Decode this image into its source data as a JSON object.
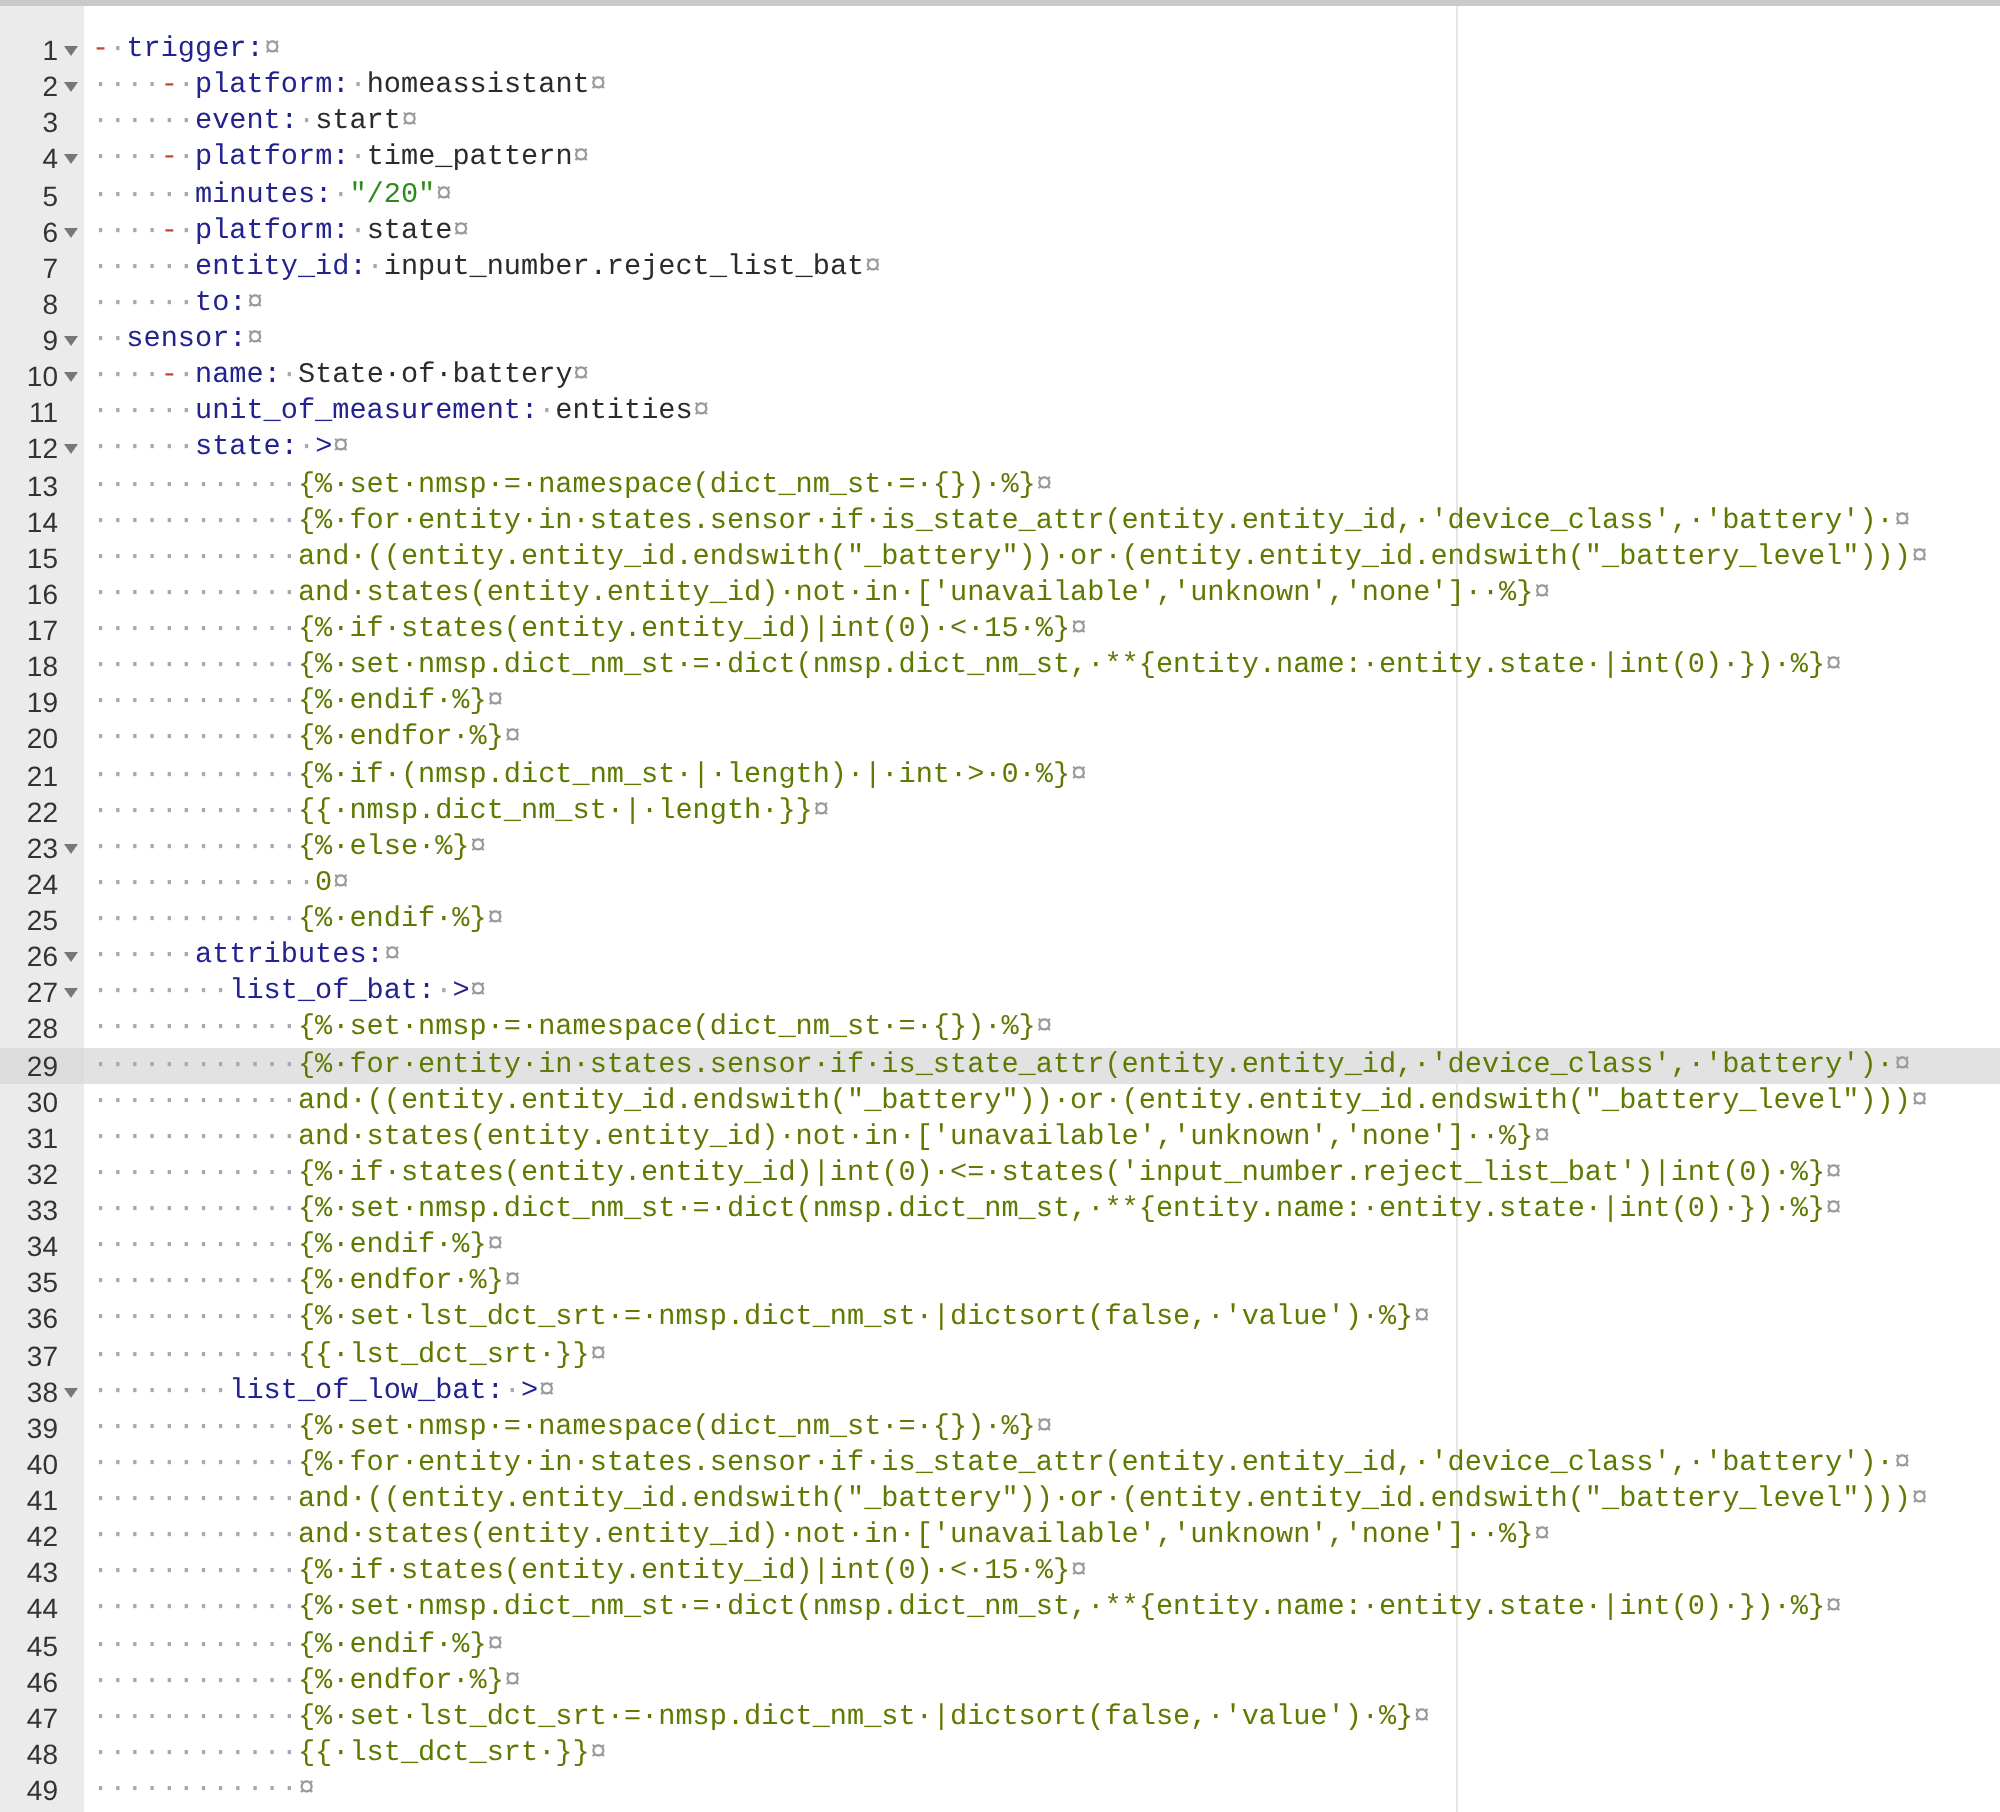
{
  "editor": {
    "lines": [
      {
        "number": "1",
        "fold": true,
        "current": false,
        "tokens": [
          {
            "kind": "dash",
            "text": "-"
          },
          {
            "kind": "ws",
            "text": "·"
          },
          {
            "kind": "key",
            "text": "trigger:"
          },
          {
            "kind": "eol",
            "text": "¤"
          }
        ]
      },
      {
        "number": "2",
        "fold": true,
        "current": false,
        "tokens": [
          {
            "kind": "ws",
            "text": "····"
          },
          {
            "kind": "dash",
            "text": "-"
          },
          {
            "kind": "ws",
            "text": "·"
          },
          {
            "kind": "key",
            "text": "platform:"
          },
          {
            "kind": "ws",
            "text": "·"
          },
          {
            "kind": "value",
            "text": "homeassistant"
          },
          {
            "kind": "eol",
            "text": "¤"
          }
        ]
      },
      {
        "number": "3",
        "fold": false,
        "current": false,
        "tokens": [
          {
            "kind": "ws",
            "text": "······"
          },
          {
            "kind": "key",
            "text": "event:"
          },
          {
            "kind": "ws",
            "text": "·"
          },
          {
            "kind": "value",
            "text": "start"
          },
          {
            "kind": "eol",
            "text": "¤"
          }
        ]
      },
      {
        "number": "4",
        "fold": true,
        "current": false,
        "tokens": [
          {
            "kind": "ws",
            "text": "····"
          },
          {
            "kind": "dash",
            "text": "-"
          },
          {
            "kind": "ws",
            "text": "·"
          },
          {
            "kind": "key",
            "text": "platform:"
          },
          {
            "kind": "ws",
            "text": "·"
          },
          {
            "kind": "value",
            "text": "time_pattern"
          },
          {
            "kind": "eol",
            "text": "¤"
          }
        ]
      },
      {
        "number": "5",
        "fold": false,
        "current": false,
        "tokens": [
          {
            "kind": "ws",
            "text": "······"
          },
          {
            "kind": "key",
            "text": "minutes:"
          },
          {
            "kind": "ws",
            "text": "·"
          },
          {
            "kind": "string",
            "text": "\"/20\""
          },
          {
            "kind": "eol",
            "text": "¤"
          }
        ]
      },
      {
        "number": "6",
        "fold": true,
        "current": false,
        "tokens": [
          {
            "kind": "ws",
            "text": "····"
          },
          {
            "kind": "dash",
            "text": "-"
          },
          {
            "kind": "ws",
            "text": "·"
          },
          {
            "kind": "key",
            "text": "platform:"
          },
          {
            "kind": "ws",
            "text": "·"
          },
          {
            "kind": "value",
            "text": "state"
          },
          {
            "kind": "eol",
            "text": "¤"
          }
        ]
      },
      {
        "number": "7",
        "fold": false,
        "current": false,
        "tokens": [
          {
            "kind": "ws",
            "text": "······"
          },
          {
            "kind": "key",
            "text": "entity_id:"
          },
          {
            "kind": "ws",
            "text": "·"
          },
          {
            "kind": "value",
            "text": "input_number.reject_list_bat"
          },
          {
            "kind": "eol",
            "text": "¤"
          }
        ]
      },
      {
        "number": "8",
        "fold": false,
        "current": false,
        "tokens": [
          {
            "kind": "ws",
            "text": "······"
          },
          {
            "kind": "key",
            "text": "to:"
          },
          {
            "kind": "eol",
            "text": "¤"
          }
        ]
      },
      {
        "number": "9",
        "fold": true,
        "current": false,
        "tokens": [
          {
            "kind": "ws",
            "text": "··"
          },
          {
            "kind": "key",
            "text": "sensor:"
          },
          {
            "kind": "eol",
            "text": "¤"
          }
        ]
      },
      {
        "number": "10",
        "fold": true,
        "current": false,
        "tokens": [
          {
            "kind": "ws",
            "text": "····"
          },
          {
            "kind": "dash",
            "text": "-"
          },
          {
            "kind": "ws",
            "text": "·"
          },
          {
            "kind": "key",
            "text": "name:"
          },
          {
            "kind": "ws",
            "text": "·"
          },
          {
            "kind": "value",
            "text": "State·of·battery"
          },
          {
            "kind": "eol",
            "text": "¤"
          }
        ]
      },
      {
        "number": "11",
        "fold": false,
        "current": false,
        "tokens": [
          {
            "kind": "ws",
            "text": "······"
          },
          {
            "kind": "key",
            "text": "unit_of_measurement:"
          },
          {
            "kind": "ws",
            "text": "·"
          },
          {
            "kind": "value",
            "text": "entities"
          },
          {
            "kind": "eol",
            "text": "¤"
          }
        ]
      },
      {
        "number": "12",
        "fold": true,
        "current": false,
        "tokens": [
          {
            "kind": "ws",
            "text": "······"
          },
          {
            "kind": "key",
            "text": "state:"
          },
          {
            "kind": "ws",
            "text": "·"
          },
          {
            "kind": "indicator",
            "text": ">"
          },
          {
            "kind": "eol",
            "text": "¤"
          }
        ]
      },
      {
        "number": "13",
        "fold": false,
        "current": false,
        "tokens": [
          {
            "kind": "ws",
            "text": "············"
          },
          {
            "kind": "template",
            "text": "{%·set·nmsp·=·namespace(dict_nm_st·=·{})·%}"
          },
          {
            "kind": "eol",
            "text": "¤"
          }
        ]
      },
      {
        "number": "14",
        "fold": false,
        "current": false,
        "tokens": [
          {
            "kind": "ws",
            "text": "············"
          },
          {
            "kind": "template",
            "text": "{%·for·entity·in·states.sensor·if·is_state_attr(entity.entity_id,·'device_class',·'battery')·"
          },
          {
            "kind": "eol",
            "text": "¤"
          }
        ]
      },
      {
        "number": "15",
        "fold": false,
        "current": false,
        "tokens": [
          {
            "kind": "ws",
            "text": "············"
          },
          {
            "kind": "template",
            "text": "and·((entity.entity_id.endswith(\"_battery\"))·or·(entity.entity_id.endswith(\"_battery_level\")))"
          },
          {
            "kind": "eol",
            "text": "¤"
          }
        ]
      },
      {
        "number": "16",
        "fold": false,
        "current": false,
        "tokens": [
          {
            "kind": "ws",
            "text": "············"
          },
          {
            "kind": "template",
            "text": "and·states(entity.entity_id)·not·in·['unavailable','unknown','none']··%}"
          },
          {
            "kind": "eol",
            "text": "¤"
          }
        ]
      },
      {
        "number": "17",
        "fold": false,
        "current": false,
        "tokens": [
          {
            "kind": "ws",
            "text": "············"
          },
          {
            "kind": "template",
            "text": "{%·if·states(entity.entity_id)|int(0)·<·15·%}"
          },
          {
            "kind": "eol",
            "text": "¤"
          }
        ]
      },
      {
        "number": "18",
        "fold": false,
        "current": false,
        "tokens": [
          {
            "kind": "ws",
            "text": "············"
          },
          {
            "kind": "template",
            "text": "{%·set·nmsp.dict_nm_st·=·dict(nmsp.dict_nm_st,·**{entity.name:·entity.state·|int(0)·})·%}"
          },
          {
            "kind": "eol",
            "text": "¤"
          }
        ]
      },
      {
        "number": "19",
        "fold": false,
        "current": false,
        "tokens": [
          {
            "kind": "ws",
            "text": "············"
          },
          {
            "kind": "template",
            "text": "{%·endif·%}"
          },
          {
            "kind": "eol",
            "text": "¤"
          }
        ]
      },
      {
        "number": "20",
        "fold": false,
        "current": false,
        "tokens": [
          {
            "kind": "ws",
            "text": "············"
          },
          {
            "kind": "template",
            "text": "{%·endfor·%}"
          },
          {
            "kind": "eol",
            "text": "¤"
          }
        ]
      },
      {
        "number": "21",
        "fold": false,
        "current": false,
        "tokens": [
          {
            "kind": "ws",
            "text": "············"
          },
          {
            "kind": "template",
            "text": "{%·if·(nmsp.dict_nm_st·|·length)·|·int·>·0·%}"
          },
          {
            "kind": "eol",
            "text": "¤"
          }
        ]
      },
      {
        "number": "22",
        "fold": false,
        "current": false,
        "tokens": [
          {
            "kind": "ws",
            "text": "············"
          },
          {
            "kind": "template",
            "text": "{{·nmsp.dict_nm_st·|·length·}}"
          },
          {
            "kind": "eol",
            "text": "¤"
          }
        ]
      },
      {
        "number": "23",
        "fold": true,
        "current": false,
        "tokens": [
          {
            "kind": "ws",
            "text": "············"
          },
          {
            "kind": "template",
            "text": "{%·else·%}"
          },
          {
            "kind": "eol",
            "text": "¤"
          }
        ]
      },
      {
        "number": "24",
        "fold": false,
        "current": false,
        "tokens": [
          {
            "kind": "ws",
            "text": "·············"
          },
          {
            "kind": "template",
            "text": "0"
          },
          {
            "kind": "eol",
            "text": "¤"
          }
        ]
      },
      {
        "number": "25",
        "fold": false,
        "current": false,
        "tokens": [
          {
            "kind": "ws",
            "text": "············"
          },
          {
            "kind": "template",
            "text": "{%·endif·%}"
          },
          {
            "kind": "eol",
            "text": "¤"
          }
        ]
      },
      {
        "number": "26",
        "fold": true,
        "current": false,
        "tokens": [
          {
            "kind": "ws",
            "text": "······"
          },
          {
            "kind": "key",
            "text": "attributes:"
          },
          {
            "kind": "eol",
            "text": "¤"
          }
        ]
      },
      {
        "number": "27",
        "fold": true,
        "current": false,
        "tokens": [
          {
            "kind": "ws",
            "text": "········"
          },
          {
            "kind": "key",
            "text": "list_of_bat:"
          },
          {
            "kind": "ws",
            "text": "·"
          },
          {
            "kind": "indicator",
            "text": ">"
          },
          {
            "kind": "eol",
            "text": "¤"
          }
        ]
      },
      {
        "number": "28",
        "fold": false,
        "current": false,
        "tokens": [
          {
            "kind": "ws",
            "text": "············"
          },
          {
            "kind": "template",
            "text": "{%·set·nmsp·=·namespace(dict_nm_st·=·{})·%}"
          },
          {
            "kind": "eol",
            "text": "¤"
          }
        ]
      },
      {
        "number": "29",
        "fold": false,
        "current": true,
        "tokens": [
          {
            "kind": "ws",
            "text": "············"
          },
          {
            "kind": "template",
            "text": "{%·for·entity·in·states.sensor·if·is_state_attr(entity.entity_id,·'device_class',·'battery')·"
          },
          {
            "kind": "eol",
            "text": "¤"
          }
        ]
      },
      {
        "number": "30",
        "fold": false,
        "current": false,
        "tokens": [
          {
            "kind": "ws",
            "text": "············"
          },
          {
            "kind": "template",
            "text": "and·((entity.entity_id.endswith(\"_battery\"))·or·(entity.entity_id.endswith(\"_battery_level\")))"
          },
          {
            "kind": "eol",
            "text": "¤"
          }
        ]
      },
      {
        "number": "31",
        "fold": false,
        "current": false,
        "tokens": [
          {
            "kind": "ws",
            "text": "············"
          },
          {
            "kind": "template",
            "text": "and·states(entity.entity_id)·not·in·['unavailable','unknown','none']··%}"
          },
          {
            "kind": "eol",
            "text": "¤"
          }
        ]
      },
      {
        "number": "32",
        "fold": false,
        "current": false,
        "tokens": [
          {
            "kind": "ws",
            "text": "············"
          },
          {
            "kind": "template",
            "text": "{%·if·states(entity.entity_id)|int(0)·<=·states('input_number.reject_list_bat')|int(0)·%}"
          },
          {
            "kind": "eol",
            "text": "¤"
          }
        ]
      },
      {
        "number": "33",
        "fold": false,
        "current": false,
        "tokens": [
          {
            "kind": "ws",
            "text": "············"
          },
          {
            "kind": "template",
            "text": "{%·set·nmsp.dict_nm_st·=·dict(nmsp.dict_nm_st,·**{entity.name:·entity.state·|int(0)·})·%}"
          },
          {
            "kind": "eol",
            "text": "¤"
          }
        ]
      },
      {
        "number": "34",
        "fold": false,
        "current": false,
        "tokens": [
          {
            "kind": "ws",
            "text": "············"
          },
          {
            "kind": "template",
            "text": "{%·endif·%}"
          },
          {
            "kind": "eol",
            "text": "¤"
          }
        ]
      },
      {
        "number": "35",
        "fold": false,
        "current": false,
        "tokens": [
          {
            "kind": "ws",
            "text": "············"
          },
          {
            "kind": "template",
            "text": "{%·endfor·%}"
          },
          {
            "kind": "eol",
            "text": "¤"
          }
        ]
      },
      {
        "number": "36",
        "fold": false,
        "current": false,
        "tokens": [
          {
            "kind": "ws",
            "text": "············"
          },
          {
            "kind": "template",
            "text": "{%·set·lst_dct_srt·=·nmsp.dict_nm_st·|dictsort(false,·'value')·%}"
          },
          {
            "kind": "eol",
            "text": "¤"
          }
        ]
      },
      {
        "number": "37",
        "fold": false,
        "current": false,
        "tokens": [
          {
            "kind": "ws",
            "text": "············"
          },
          {
            "kind": "template",
            "text": "{{·lst_dct_srt·}}"
          },
          {
            "kind": "eol",
            "text": "¤"
          }
        ]
      },
      {
        "number": "38",
        "fold": true,
        "current": false,
        "tokens": [
          {
            "kind": "ws",
            "text": "········"
          },
          {
            "kind": "key",
            "text": "list_of_low_bat:"
          },
          {
            "kind": "ws",
            "text": "·"
          },
          {
            "kind": "indicator",
            "text": ">"
          },
          {
            "kind": "eol",
            "text": "¤"
          }
        ]
      },
      {
        "number": "39",
        "fold": false,
        "current": false,
        "tokens": [
          {
            "kind": "ws",
            "text": "············"
          },
          {
            "kind": "template",
            "text": "{%·set·nmsp·=·namespace(dict_nm_st·=·{})·%}"
          },
          {
            "kind": "eol",
            "text": "¤"
          }
        ]
      },
      {
        "number": "40",
        "fold": false,
        "current": false,
        "tokens": [
          {
            "kind": "ws",
            "text": "············"
          },
          {
            "kind": "template",
            "text": "{%·for·entity·in·states.sensor·if·is_state_attr(entity.entity_id,·'device_class',·'battery')·"
          },
          {
            "kind": "eol",
            "text": "¤"
          }
        ]
      },
      {
        "number": "41",
        "fold": false,
        "current": false,
        "tokens": [
          {
            "kind": "ws",
            "text": "············"
          },
          {
            "kind": "template",
            "text": "and·((entity.entity_id.endswith(\"_battery\"))·or·(entity.entity_id.endswith(\"_battery_level\")))"
          },
          {
            "kind": "eol",
            "text": "¤"
          }
        ]
      },
      {
        "number": "42",
        "fold": false,
        "current": false,
        "tokens": [
          {
            "kind": "ws",
            "text": "············"
          },
          {
            "kind": "template",
            "text": "and·states(entity.entity_id)·not·in·['unavailable','unknown','none']··%}"
          },
          {
            "kind": "eol",
            "text": "¤"
          }
        ]
      },
      {
        "number": "43",
        "fold": false,
        "current": false,
        "tokens": [
          {
            "kind": "ws",
            "text": "············"
          },
          {
            "kind": "template",
            "text": "{%·if·states(entity.entity_id)|int(0)·<·15·%}"
          },
          {
            "kind": "eol",
            "text": "¤"
          }
        ]
      },
      {
        "number": "44",
        "fold": false,
        "current": false,
        "tokens": [
          {
            "kind": "ws",
            "text": "············"
          },
          {
            "kind": "template",
            "text": "{%·set·nmsp.dict_nm_st·=·dict(nmsp.dict_nm_st,·**{entity.name:·entity.state·|int(0)·})·%}"
          },
          {
            "kind": "eol",
            "text": "¤"
          }
        ]
      },
      {
        "number": "45",
        "fold": false,
        "current": false,
        "tokens": [
          {
            "kind": "ws",
            "text": "············"
          },
          {
            "kind": "template",
            "text": "{%·endif·%}"
          },
          {
            "kind": "eol",
            "text": "¤"
          }
        ]
      },
      {
        "number": "46",
        "fold": false,
        "current": false,
        "tokens": [
          {
            "kind": "ws",
            "text": "············"
          },
          {
            "kind": "template",
            "text": "{%·endfor·%}"
          },
          {
            "kind": "eol",
            "text": "¤"
          }
        ]
      },
      {
        "number": "47",
        "fold": false,
        "current": false,
        "tokens": [
          {
            "kind": "ws",
            "text": "············"
          },
          {
            "kind": "template",
            "text": "{%·set·lst_dct_srt·=·nmsp.dict_nm_st·|dictsort(false,·'value')·%}"
          },
          {
            "kind": "eol",
            "text": "¤"
          }
        ]
      },
      {
        "number": "48",
        "fold": false,
        "current": false,
        "tokens": [
          {
            "kind": "ws",
            "text": "············"
          },
          {
            "kind": "template",
            "text": "{{·lst_dct_srt·}}"
          },
          {
            "kind": "eol",
            "text": "¤"
          }
        ]
      },
      {
        "number": "49",
        "fold": false,
        "current": false,
        "tokens": [
          {
            "kind": "ws",
            "text": "············"
          },
          {
            "kind": "eol",
            "text": "¤"
          }
        ]
      }
    ]
  }
}
